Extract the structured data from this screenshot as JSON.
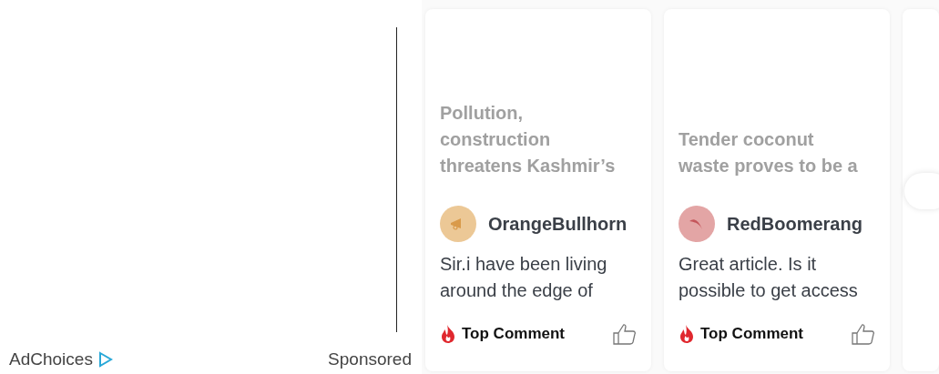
{
  "ad_footer": {
    "adchoices": "AdChoices",
    "sponsored": "Sponsored"
  },
  "cards": [
    {
      "title": "Pollution, construction threatens Kashmir’s",
      "author": "OrangeBullhorn",
      "kind": "megaphone",
      "color": "#ecc896",
      "comment": "Sir.i have been living around the edge of",
      "badge": "Top Comment"
    },
    {
      "title": "Tender coconut waste proves to be a",
      "author": "RedBoomerang",
      "kind": "boomerang",
      "color": "#e3a5a5",
      "comment": "Great article. Is it possible to get access",
      "badge": "Top Comment"
    }
  ]
}
